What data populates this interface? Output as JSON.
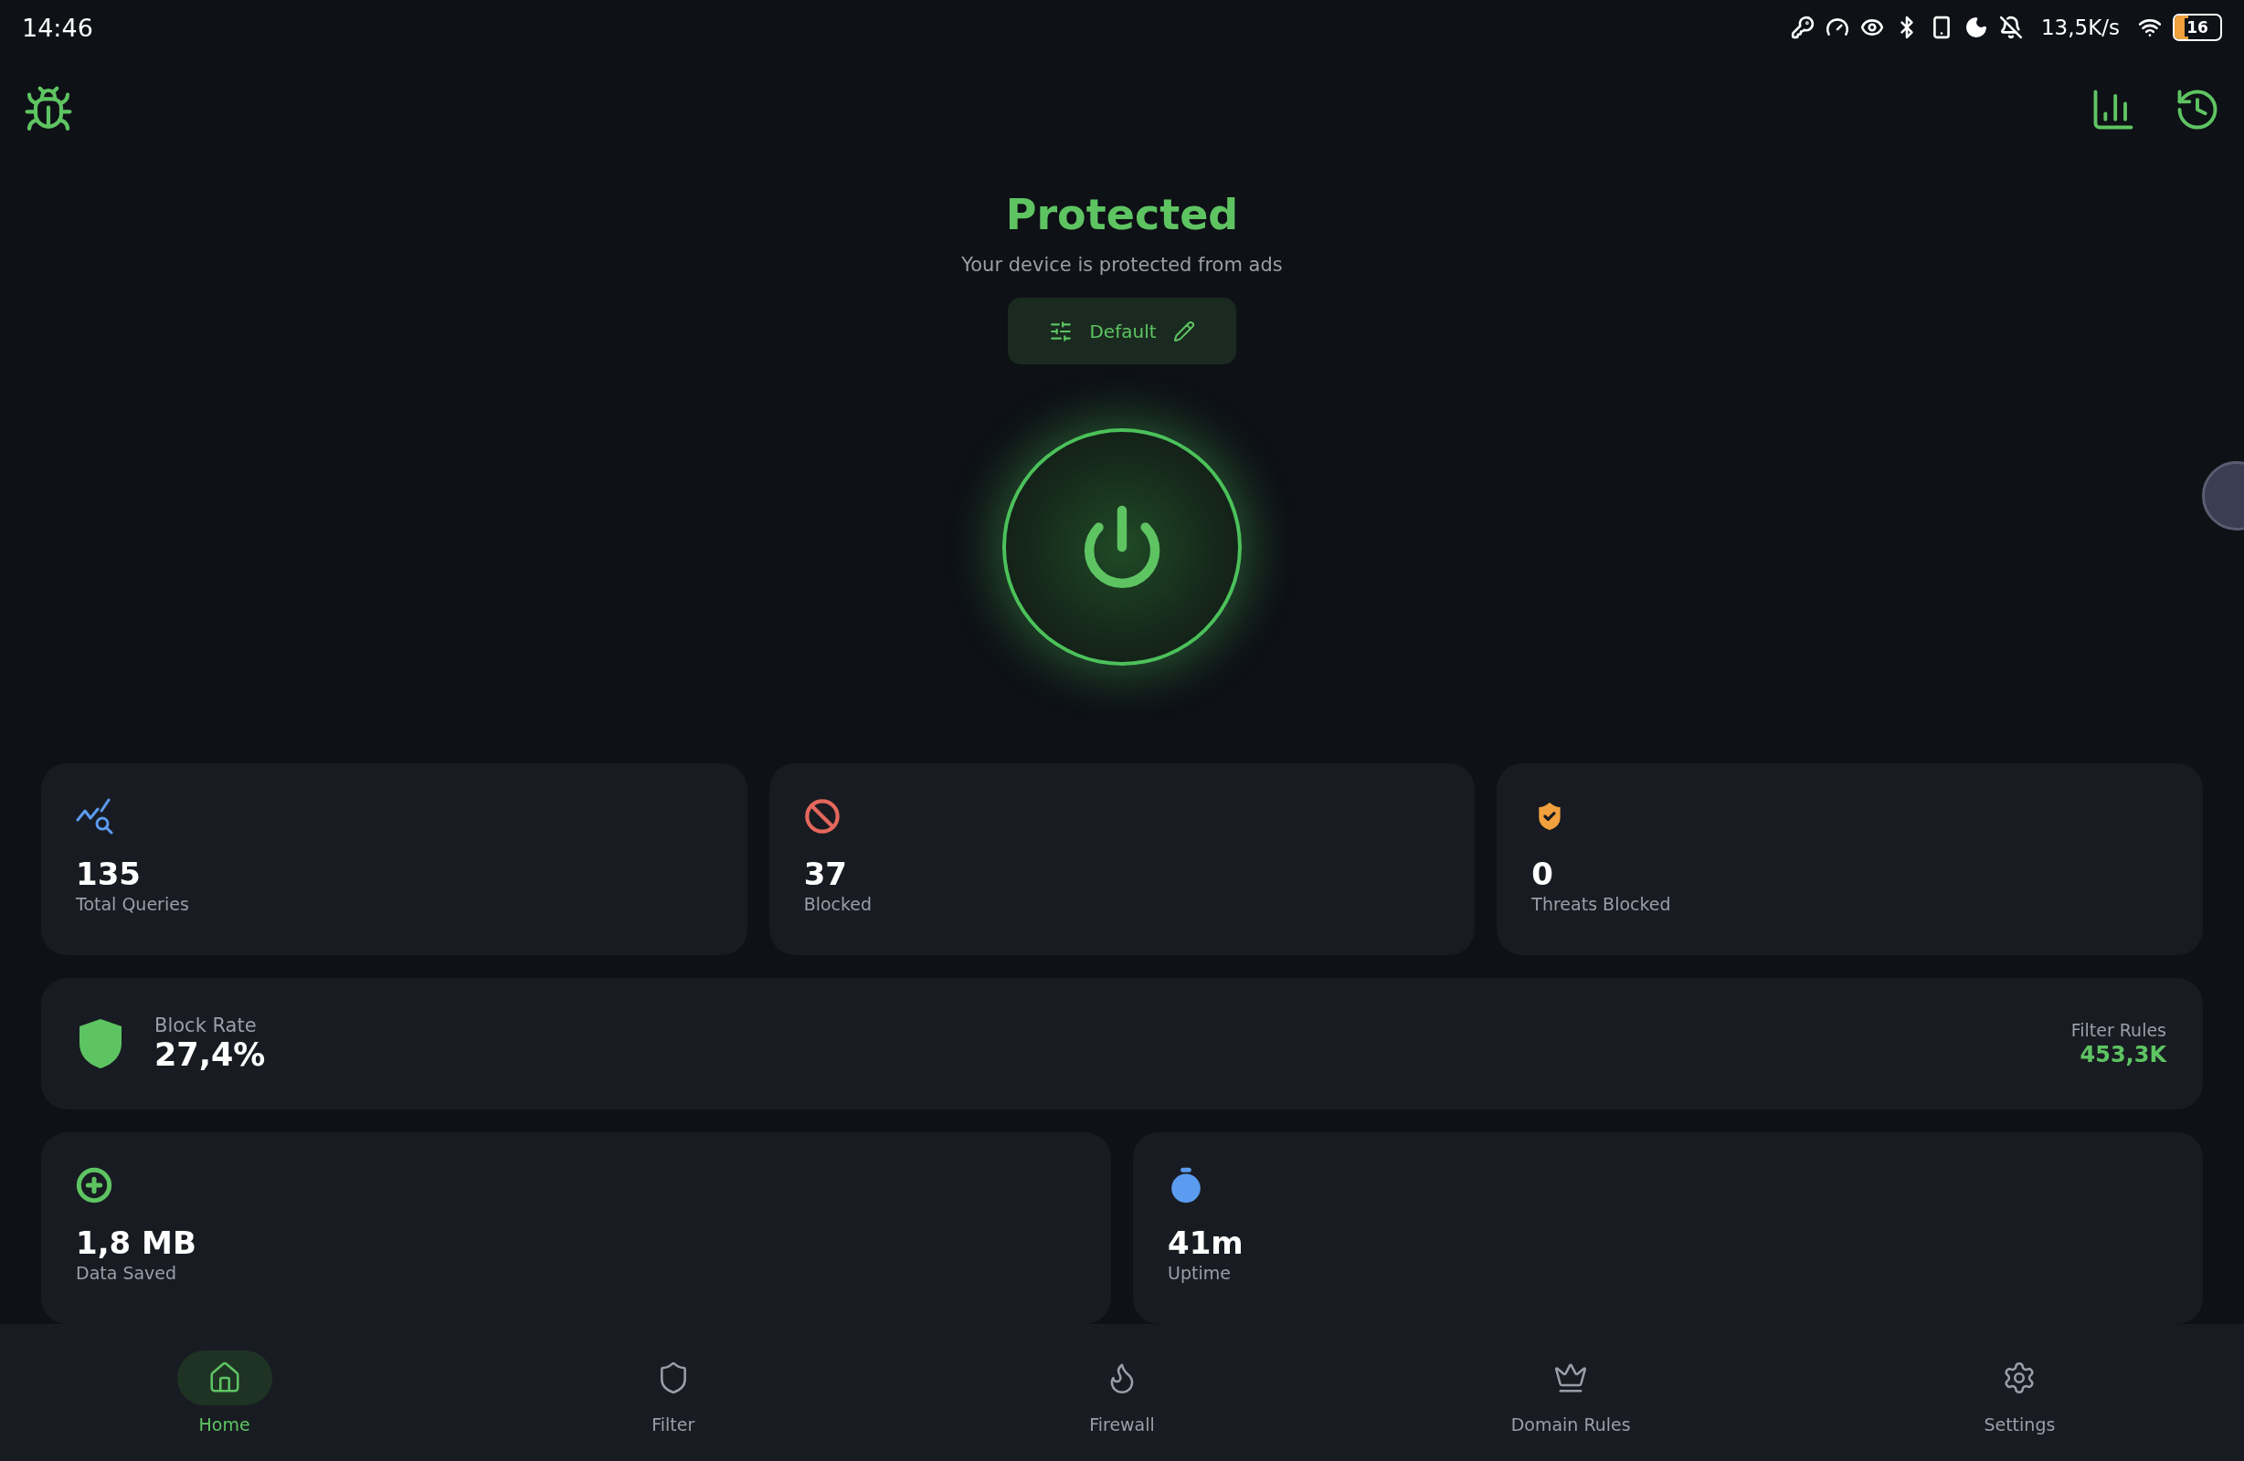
{
  "status_bar": {
    "time": "14:46",
    "network_speed": "13,5K/s",
    "battery": "16"
  },
  "header": {
    "title": "Protected",
    "subtitle": "Your device is protected from ads",
    "profile_button": "Default"
  },
  "power_button": {
    "on": true
  },
  "stats": [
    {
      "kind": "queries",
      "value": "135",
      "label": "Total Queries",
      "color": "#5b9bf0"
    },
    {
      "kind": "blocked",
      "value": "37",
      "label": "Blocked",
      "color": "#e5675c"
    },
    {
      "kind": "threats",
      "value": "0",
      "label": "Threats Blocked",
      "color": "#f0a03c"
    }
  ],
  "block_rate": {
    "label": "Block Rate",
    "value": "27,4%",
    "filter_rules_label": "Filter Rules",
    "filter_rules_value": "453,3K"
  },
  "extra_stats": [
    {
      "kind": "data",
      "value": "1,8 MB",
      "label": "Data Saved",
      "color": "#5ec462"
    },
    {
      "kind": "uptime",
      "value": "41m",
      "label": "Uptime",
      "color": "#5b9bf0"
    }
  ],
  "nav": [
    {
      "kind": "home",
      "label": "Home",
      "selected": true
    },
    {
      "kind": "filter",
      "label": "Filter",
      "selected": false
    },
    {
      "kind": "firewall",
      "label": "Firewall",
      "selected": false
    },
    {
      "kind": "domains",
      "label": "Domain Rules",
      "selected": false
    },
    {
      "kind": "settings",
      "label": "Settings",
      "selected": false
    }
  ]
}
